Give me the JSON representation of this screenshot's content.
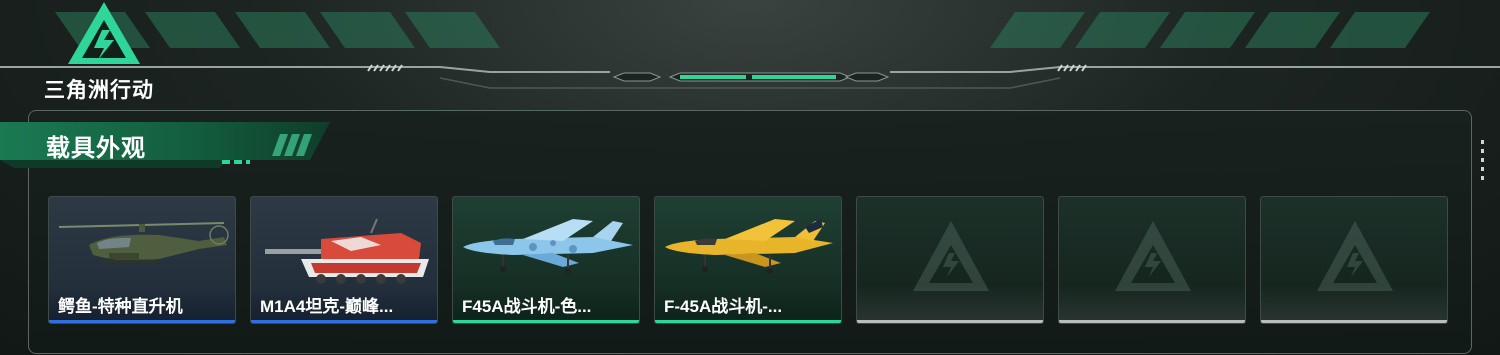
{
  "header": {
    "logo_text": "三角洲行动",
    "accent_color": "#2fd69a"
  },
  "section": {
    "title": "载具外观"
  },
  "cards": [
    {
      "name": "鳄鱼-特种直升机",
      "icon": "helicopter-icon",
      "rarity_color": "#2f6fe0"
    },
    {
      "name": "M1A4坦克-巅峰...",
      "icon": "tank-icon",
      "rarity_color": "#2f6fe0"
    },
    {
      "name": "F45A战斗机-色...",
      "icon": "fighter-jet-icon",
      "rarity_color": "#2fd69a"
    },
    {
      "name": "F-45A战斗机-...",
      "icon": "fighter-jet-icon",
      "rarity_color": "#2fd69a"
    },
    {
      "name": "",
      "icon": "empty-slot-logo-icon",
      "rarity_color": "#b9bdbb"
    },
    {
      "name": "",
      "icon": "empty-slot-logo-icon",
      "rarity_color": "#b9bdbb"
    },
    {
      "name": "",
      "icon": "empty-slot-logo-icon",
      "rarity_color": "#b9bdbb"
    }
  ]
}
